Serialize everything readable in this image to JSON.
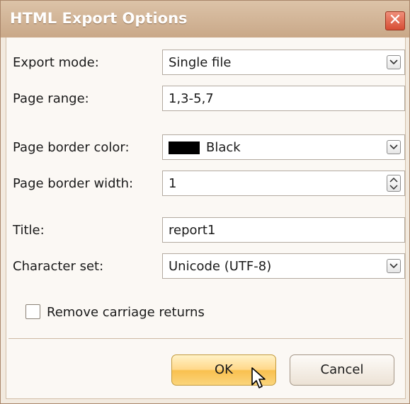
{
  "window": {
    "title": "HTML Export Options",
    "close_symbol": "✕"
  },
  "form": {
    "export_mode": {
      "label": "Export mode:",
      "value": "Single file"
    },
    "page_range": {
      "label": "Page range:",
      "value": "1,3-5,7"
    },
    "page_border_color": {
      "label": "Page border color:",
      "value": "Black",
      "swatch_color": "#000000"
    },
    "page_border_width": {
      "label": "Page border width:",
      "value": "1"
    },
    "title": {
      "label": "Title:",
      "value": "report1"
    },
    "character_set": {
      "label": "Character set:",
      "value": "Unicode (UTF-8)"
    },
    "remove_carriage_returns": {
      "label": "Remove carriage returns",
      "checked": false
    }
  },
  "buttons": {
    "ok": "OK",
    "cancel": "Cancel"
  },
  "colors": {
    "titlebar": "#c9a888",
    "close_button": "#d74d34",
    "ok_button": "#f9c04f"
  }
}
